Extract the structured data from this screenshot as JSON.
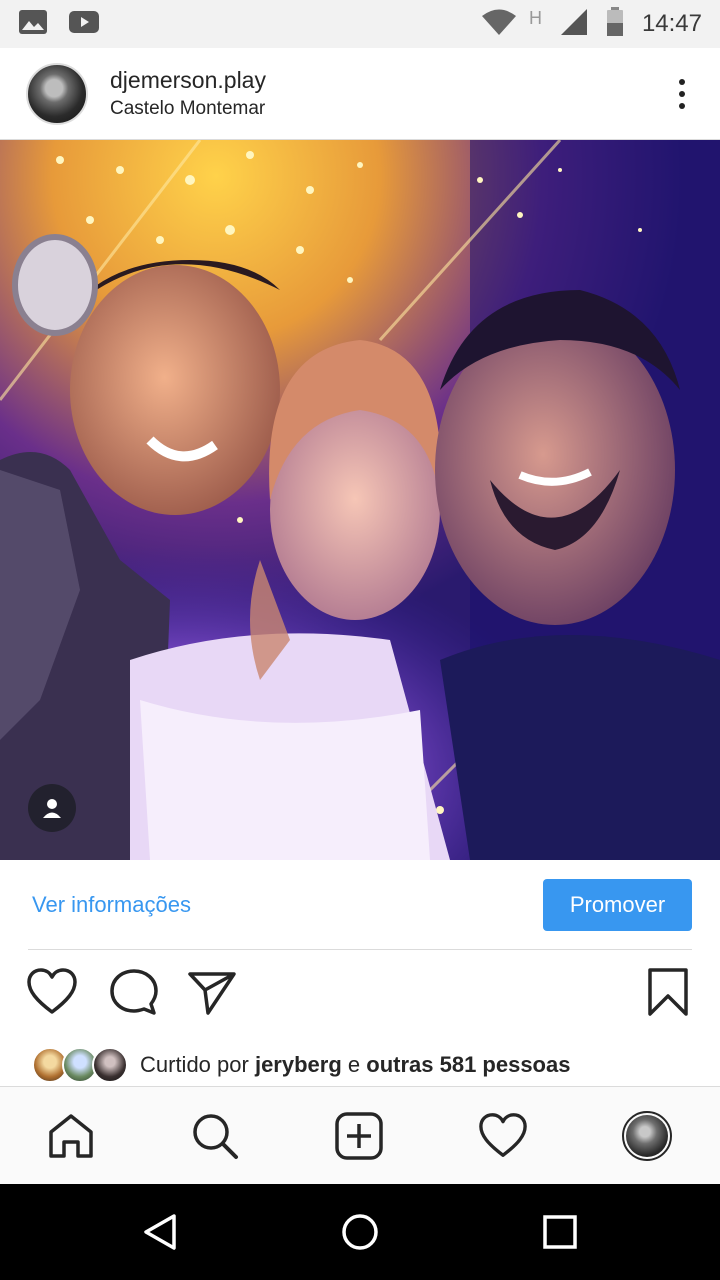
{
  "status_bar": {
    "time": "14:47",
    "network_letter": "H",
    "icons": [
      "image-icon",
      "youtube-icon",
      "wifi-icon",
      "signal-icon",
      "battery-icon"
    ]
  },
  "post": {
    "username": "djemerson.play",
    "location": "Castelo Montemar",
    "more_icon": "more-vertical-icon"
  },
  "info_bar": {
    "view_info_label": "Ver informações",
    "promote_label": "Promover",
    "accent_color": "#3897f0"
  },
  "actions": {
    "icons": [
      "heart-icon",
      "comment-icon",
      "share-icon",
      "bookmark-icon"
    ]
  },
  "likes": {
    "prefix": "Curtido por ",
    "user": "jeryberg",
    "connector": " e ",
    "others": "outras 581 pessoas"
  },
  "bottom_nav": {
    "items": [
      "home-icon",
      "search-icon",
      "add-post-icon",
      "activity-heart-icon",
      "profile-avatar"
    ]
  },
  "system_nav": {
    "items": [
      "back-icon",
      "home-circle-icon",
      "recents-icon"
    ]
  }
}
